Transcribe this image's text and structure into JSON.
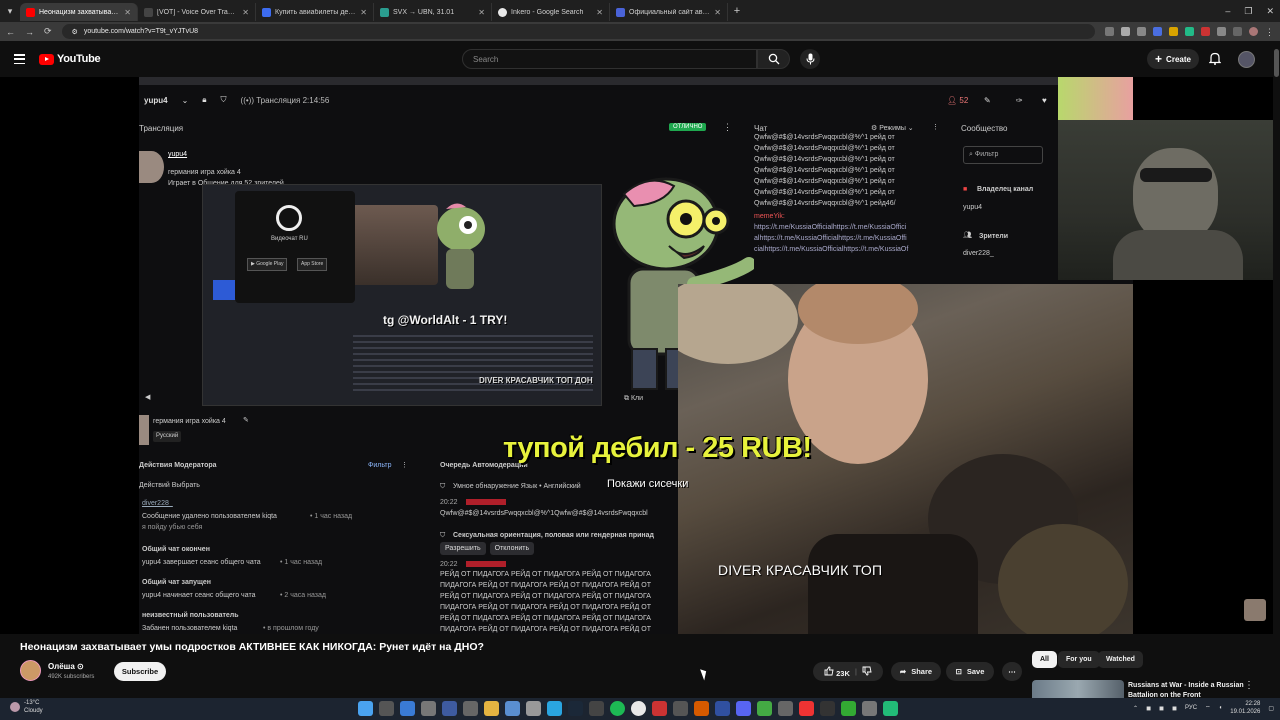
{
  "browser": {
    "tabs": [
      {
        "title": "Неонацизм захватывает у...",
        "color": "#ff0000",
        "active": true
      },
      {
        "title": "[VOT] - Voice Over Translation",
        "color": "#444444",
        "active": false
      },
      {
        "title": "Купить авиабилеты дешево о...",
        "color": "#3d6cf0",
        "active": false
      },
      {
        "title": "SVX → UBN, 31.01",
        "color": "#2a9d8f",
        "active": false
      },
      {
        "title": "Inkero - Google Search",
        "color": "#e8e8e8",
        "active": false
      },
      {
        "title": "Официальный сайт авиакомп...",
        "color": "#4a63d8",
        "active": false
      }
    ],
    "url": "youtube.com/watch?v=T9t_vYJTvU8",
    "window_controls": [
      "–",
      "❐",
      "✕"
    ]
  },
  "youtube": {
    "logo_text": "YouTube",
    "search_placeholder": "Search",
    "create_label": "Create"
  },
  "stream": {
    "channel": "yupu4",
    "live_label": "Трансляция 2:14:56",
    "viewers": "52",
    "panel_broadcast": "Трансляция",
    "status_badge": "ОТЛИЧНО",
    "streamer_name": "yupu4",
    "stream_title": "германия игра хойка 4",
    "plays_line": "Играет в Общение для 52 зрителей",
    "app_label": "Видеочат RU",
    "tg_text": "tg @WorldAlt - 1 TRY!",
    "diver_small": "DIVER КРАСАВЧИК ТОП ДОН",
    "clip_label": "Кли",
    "title_edit": "германия игра хойка 4",
    "language": "Русский",
    "chat_title": "Чат",
    "chat_mode": "Режимы",
    "chat_lines": [
      "Qwfw@#$@14vsrdsFwqqxcbl@%^1 рейд от",
      "Qwfw@#$@14vsrdsFwqqxcbl@%^1 рейд от",
      "Qwfw@#$@14vsrdsFwqqxcbl@%^1 рейд от",
      "Qwfw@#$@14vsrdsFwqqxcbl@%^1 рейд от",
      "Qwfw@#$@14vsrdsFwqqxcbl@%^1 рейд от",
      "Qwfw@#$@14vsrdsFwqqxcbl@%^1 рейд от",
      "Qwfw@#$@14vsrdsFwqqxcbl@%^1 рейд46/"
    ],
    "chat_user": "memeYik:",
    "chat_links": [
      "https://t.me/KussiaOfficialhttps://t.me/KussiaOffici",
      "alhttps://t.me/KussiaOfficialhttps://t.me/KussiaOffi",
      "cialhttps://t.me/KussiaOfficialhttps://t.me/KussiaOf"
    ],
    "community_title": "Сообщество",
    "filter_placeholder": "Фильтр",
    "owner_label": "Владелец канал",
    "owner_name": "yupu4",
    "viewers_label": "Зрители",
    "viewer_name": "diver228_",
    "mod_title": "Действия Модератора",
    "mod_filter": "Фильтр",
    "mod_select": "Действий Выбрать",
    "mod_items": [
      {
        "user": "diver228_",
        "text": "Сообщение удалено пользователем kiqta",
        "time": "• 1 час назад",
        "note": "я пойду убью себя"
      },
      {
        "user": "Общий чат окончен",
        "text": "yupu4 завершает сеанс общего чата",
        "time": "• 1 час назад",
        "note": ""
      },
      {
        "user": "Общий чат запущен",
        "text": "yupu4 начинает сеанс общего чата",
        "time": "• 2 часа назад",
        "note": ""
      },
      {
        "user": "неизвестный пользователь",
        "text": "Забанен пользователем kiqta",
        "time": "• в прошлом году",
        "note": ""
      }
    ],
    "auto_title": "Очередь Автомодерации",
    "auto_item1_label": "Умное обнаружение Язык • Английский",
    "auto_item1_time": "20:22",
    "auto_item1_text": "Qwfw@#$@14vsrdsFwqqxcbl@%^1Qwfw@#$@14vsrdsFwqqxcbl",
    "auto_item2_label": "Сексуальная ориентация, половая или гендерная принад",
    "allow_label": "Разрешить",
    "deny_label": "Отклонить",
    "auto_item3_time": "20:22",
    "raid_lines": [
      "РЕЙД ОТ ПИДАГОГА РЕЙД ОТ ПИДАГОГА РЕЙД ОТ ПИДАГОГА",
      "ПИДАГОГА РЕЙД ОТ ПИДАГОГА РЕЙД ОТ ПИДАГОГА РЕЙД ОТ",
      "РЕЙД ОТ ПИДАГОГА РЕЙД ОТ ПИДАГОГА РЕЙД ОТ ПИДАГОГА",
      "ПИДАГОГА РЕЙД ОТ ПИДАГОГА РЕЙД ОТ ПИДАГОГА РЕЙД ОТ",
      "РЕЙД ОТ ПИДАГОГА РЕЙД ОТ ПИДАГОГА РЕЙД ОТ ПИДАГОГА",
      "ПИДАГОГА РЕЙД ОТ ПИДАГОГА РЕЙД ОТ ПИДАГОГА РЕЙД ОТ"
    ],
    "donation_overlay": "тупой дебил - 25 RUB!",
    "donation_sub": "Покажи сисечки",
    "diver_big": "DIVER КРАСАВЧИК ТОП"
  },
  "video": {
    "title": "Неонацизм захватывает умы подростков АКТИВНЕЕ КАК НИКОГДА: Рунет идёт на ДНО?",
    "channel_name": "Олёша ⊙",
    "subscribers": "492K subscribers",
    "subscribe_label": "Subscribe",
    "likes": "23K",
    "share_label": "Share",
    "save_label": "Save"
  },
  "recommendations": {
    "chips": [
      "All",
      "For you",
      "Watched"
    ],
    "first_title": "Russians at War - Inside a Russian Battalion on the Front"
  },
  "taskbar": {
    "temperature": "-13°C",
    "weather": "Cloudy",
    "lang": "РУС",
    "time": "22:28",
    "date": "19.01.2026"
  },
  "colors": {
    "youtube_red": "#ff0000",
    "overlay_yellow": "#e7f23c",
    "status_green": "#1fa84f"
  }
}
